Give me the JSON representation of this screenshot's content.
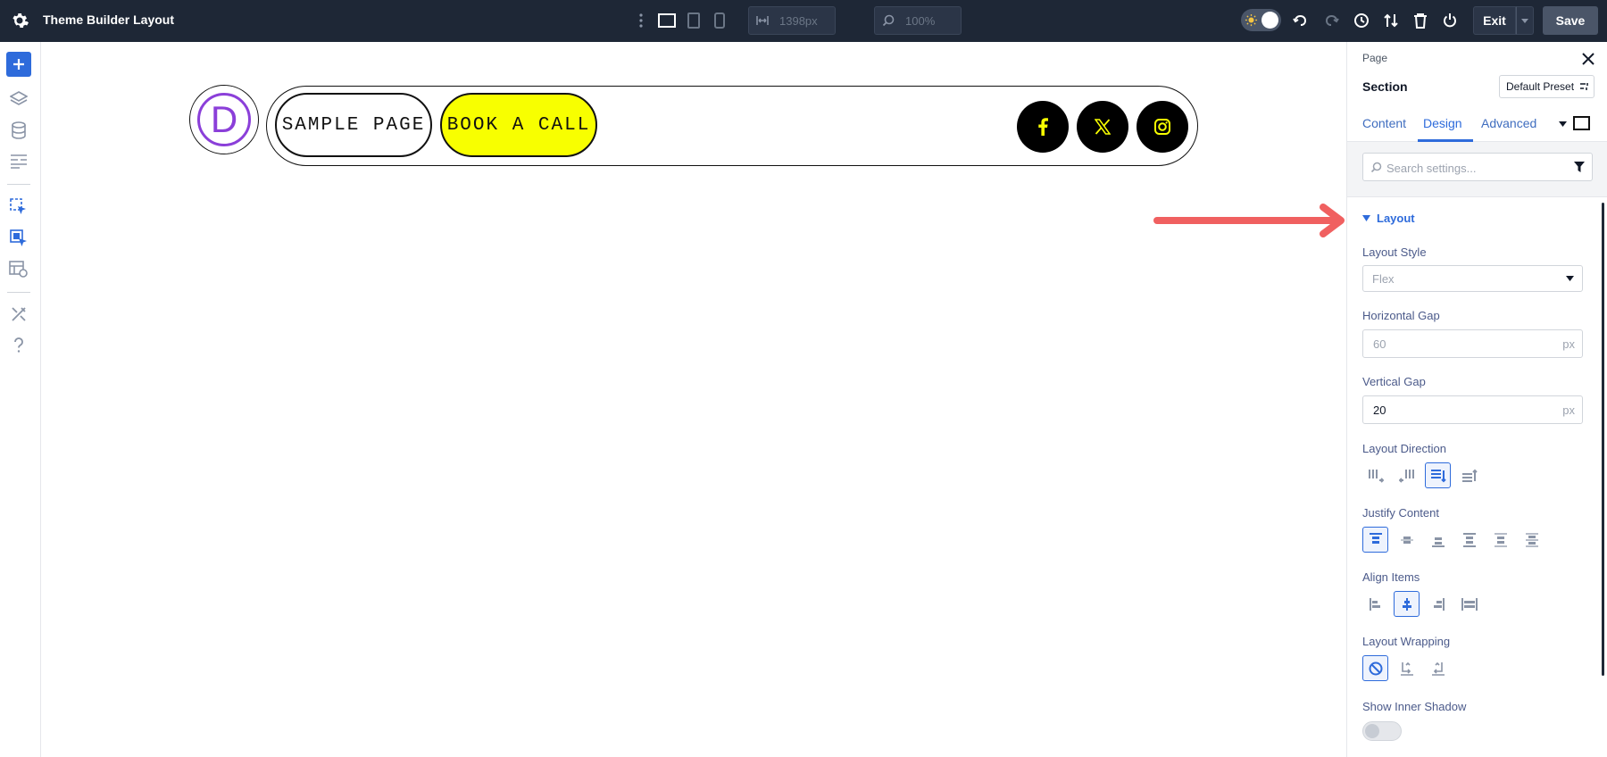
{
  "topbar": {
    "title": "Theme Builder Layout",
    "width_value": "1398px",
    "zoom_value": "100%",
    "exit_label": "Exit",
    "save_label": "Save"
  },
  "canvas": {
    "logo_letter": "D",
    "nav_items": [
      {
        "label": "SAMPLE PAGE"
      },
      {
        "label": "BOOK A CALL"
      }
    ],
    "social_icons": [
      "facebook-icon",
      "x-icon",
      "instagram-icon"
    ],
    "accent_yellow": "#f8ff00",
    "logo_purple": "#8b3fd9"
  },
  "panel": {
    "breadcrumb": "Page",
    "title": "Section",
    "preset_label": "Default Preset",
    "tabs": [
      {
        "label": "Content"
      },
      {
        "label": "Design"
      },
      {
        "label": "Advanced"
      }
    ],
    "active_tab": "Design",
    "search_placeholder": "Search settings...",
    "section_title": "Layout",
    "layout_style_label": "Layout Style",
    "layout_style_value": "Flex",
    "horizontal_gap_label": "Horizontal Gap",
    "horizontal_gap_placeholder": "60",
    "horizontal_gap_unit": "px",
    "vertical_gap_label": "Vertical Gap",
    "vertical_gap_value": "20",
    "vertical_gap_unit": "px",
    "layout_direction_label": "Layout Direction",
    "justify_content_label": "Justify Content",
    "align_items_label": "Align Items",
    "layout_wrapping_label": "Layout Wrapping",
    "inner_shadow_label": "Show Inner Shadow",
    "accent_color": "#2e6bdb"
  }
}
